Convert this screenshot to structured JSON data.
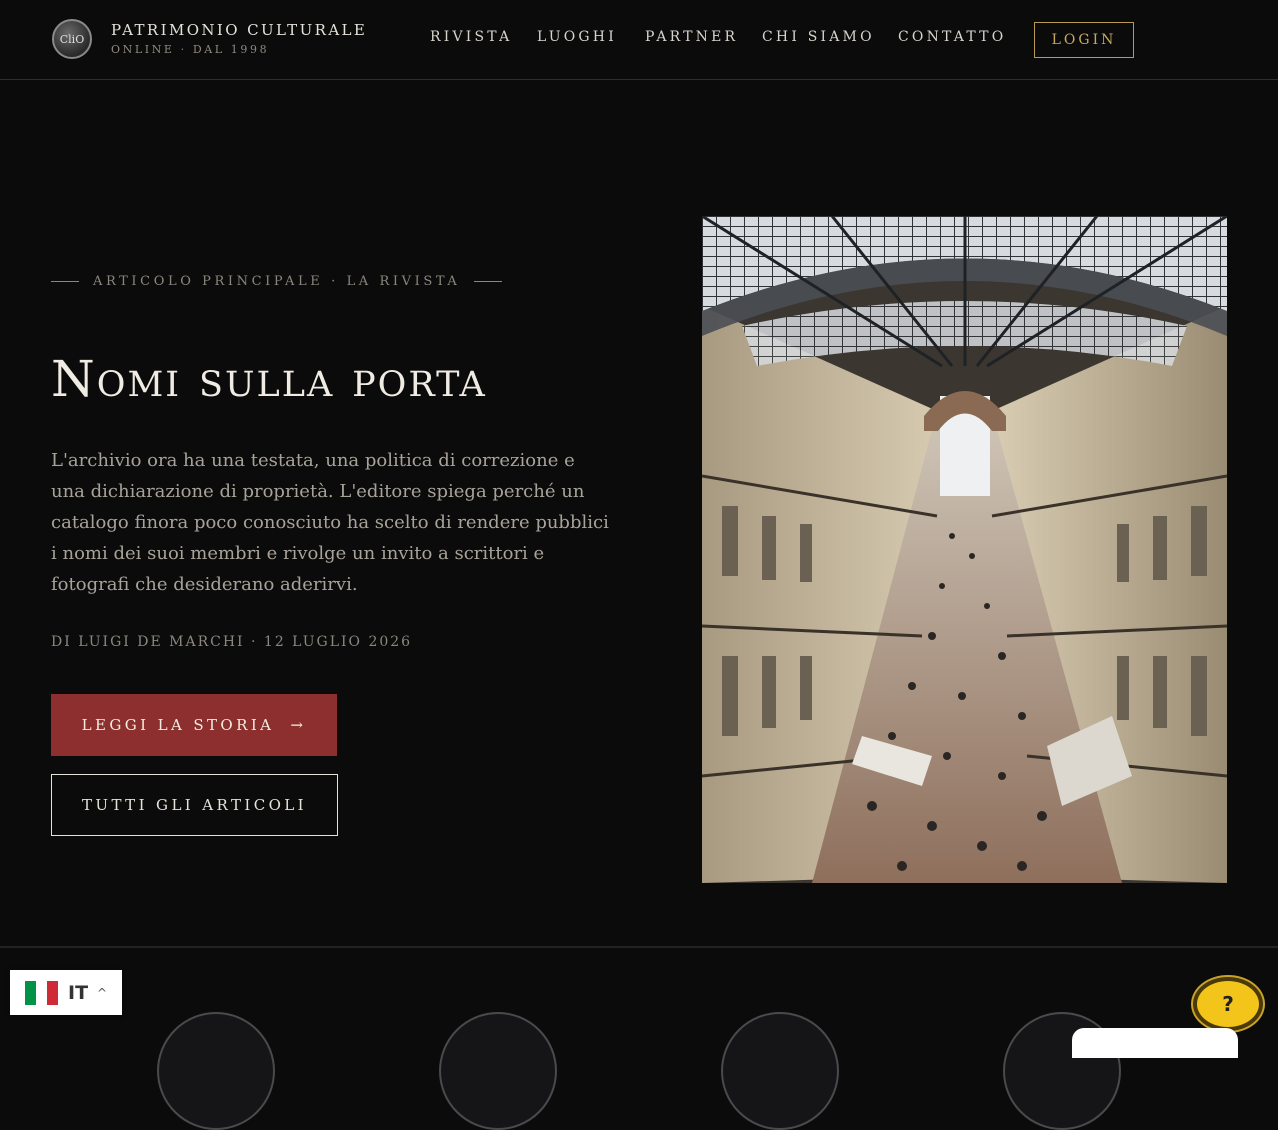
{
  "header": {
    "brand_title": "PATRIMONIO CULTURALE",
    "brand_subtitle": "ONLINE · DAL 1998",
    "logo_text": "CliO",
    "nav": [
      "RIVISTA",
      "LUOGHI",
      "PARTNER",
      "CHI SIAMO",
      "CONTATTO"
    ],
    "login_label": "LOGIN"
  },
  "hero": {
    "eyebrow": "ARTICOLO PRINCIPALE · LA RIVISTA",
    "title": "Nomi sulla porta",
    "description": "L'archivio ora ha una testata, una politica di correzione e una dichiarazione di proprietà. L'editore spiega perché un catalogo finora poco conosciuto ha scelto di rendere pubblici i nomi dei suoi membri e rivolge un invito a scrittori e fotografi che desiderano aderirvi.",
    "byline": "DI LUIGI DE MARCHI · 12 LUGLIO 2026",
    "primary_button": "LEGGI LA STORIA",
    "primary_arrow": "→",
    "secondary_button": "TUTTI GLI ARTICOLI"
  },
  "widgets": {
    "language_code": "IT",
    "caret": "^",
    "help_label": "?"
  },
  "colors": {
    "background": "#0b0b0c",
    "accent_red": "#8c2f2e",
    "accent_gold": "#c9a85d",
    "help_yellow": "#f3c419"
  }
}
